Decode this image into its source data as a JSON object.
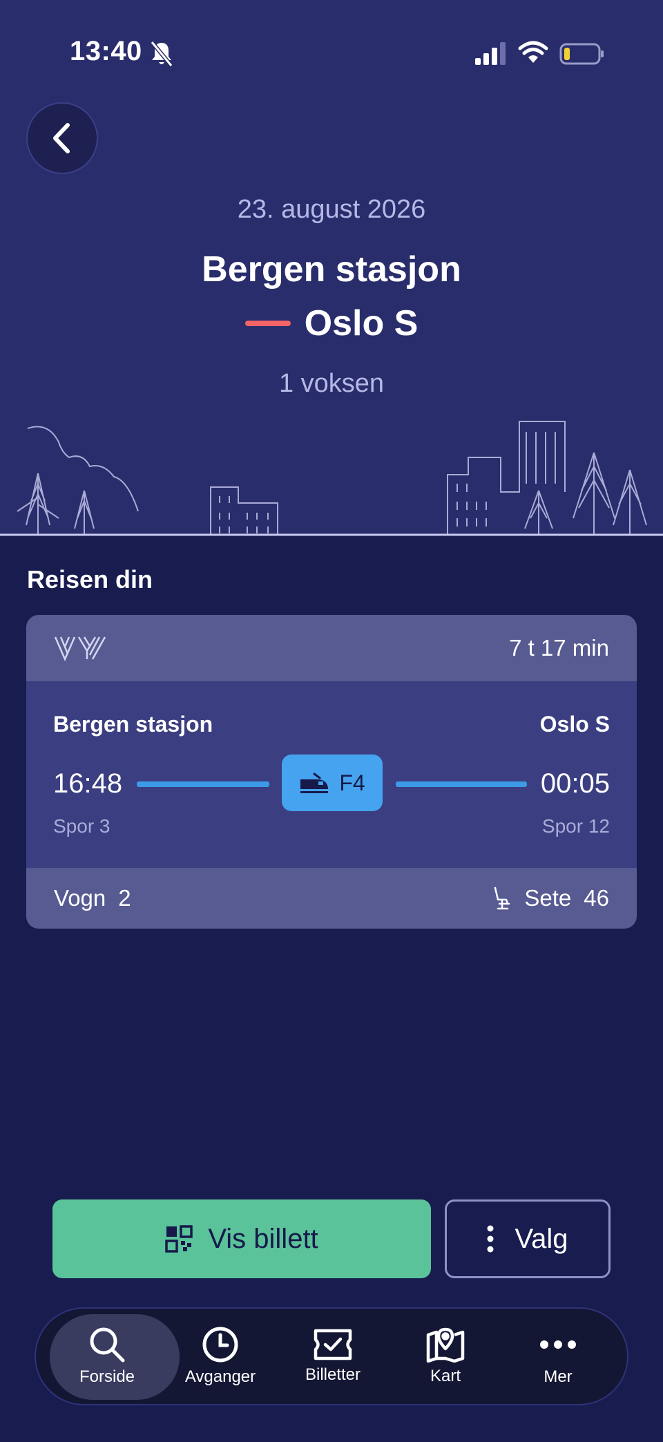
{
  "status_bar": {
    "time": "13:40"
  },
  "trip": {
    "date": "23. august 2026",
    "from": "Bergen stasjon",
    "to": "Oslo S",
    "passengers": "1 voksen"
  },
  "section": {
    "title": "Reisen din"
  },
  "journey": {
    "operator_logo": "vy-logo",
    "duration": "7 t 17 min",
    "departure_station": "Bergen stasjon",
    "arrival_station": "Oslo S",
    "departure_time": "16:48",
    "arrival_time": "00:05",
    "train_line": "F4",
    "departure_track": "Spor 3",
    "arrival_track": "Spor 12",
    "wagon_label": "Vogn",
    "wagon_number": "2",
    "seat_label": "Sete",
    "seat_number": "46"
  },
  "actions": {
    "ticket_label": "Vis billett",
    "options_label": "Valg"
  },
  "nav": {
    "items": [
      {
        "label": "Forside",
        "icon": "search-icon",
        "active": true
      },
      {
        "label": "Avganger",
        "icon": "clock-icon",
        "active": false
      },
      {
        "label": "Billetter",
        "icon": "ticket-icon",
        "active": false
      },
      {
        "label": "Kart",
        "icon": "map-icon",
        "active": false
      },
      {
        "label": "Mer",
        "icon": "more-icon",
        "active": false
      }
    ]
  },
  "colors": {
    "hero_bg": "#2a2d6b",
    "page_bg": "#181c4e",
    "accent_green": "#5bc39a",
    "route_blue": "#3d9ae6",
    "route_dash_red": "#f26466"
  }
}
